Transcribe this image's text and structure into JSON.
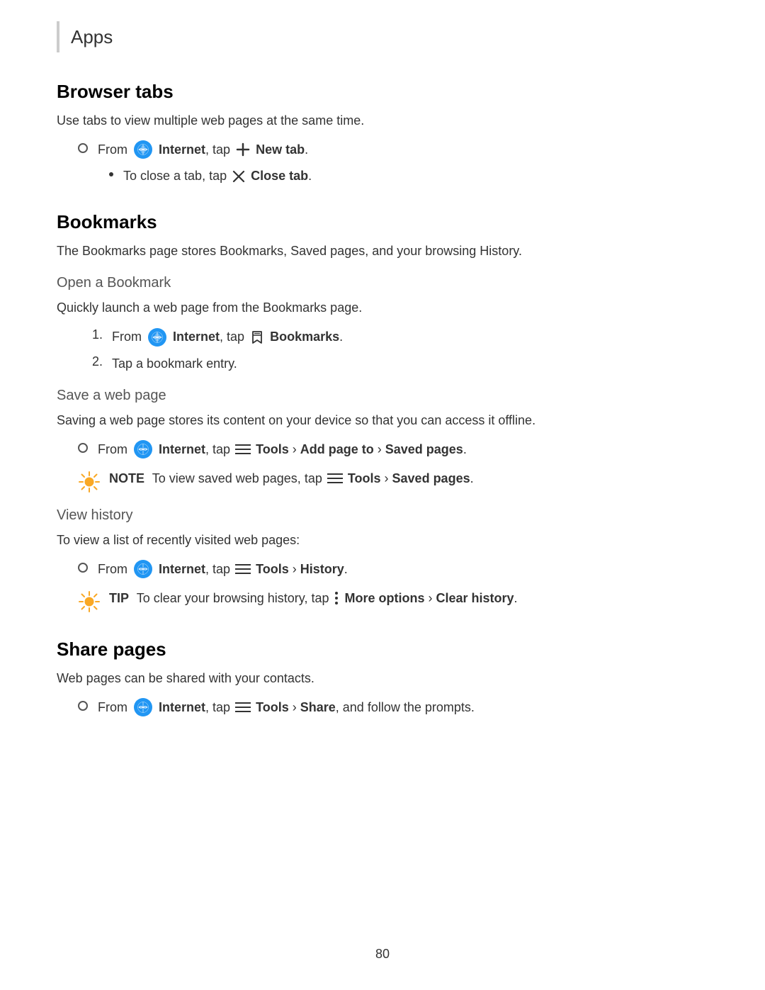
{
  "header": {
    "bar": true,
    "title": "Apps"
  },
  "sections": [
    {
      "id": "browser-tabs",
      "title": "Browser tabs",
      "type": "main",
      "body": "Use tabs to view multiple web pages at the same time.",
      "items": [
        {
          "type": "circle-bullet",
          "text_parts": [
            {
              "type": "text",
              "value": "From "
            },
            {
              "type": "internet-icon"
            },
            {
              "type": "bold",
              "value": "Internet"
            },
            {
              "type": "text",
              "value": ", tap "
            },
            {
              "type": "plus-icon"
            },
            {
              "type": "bold",
              "value": "New tab"
            },
            {
              "type": "text",
              "value": "."
            }
          ],
          "sub_items": [
            {
              "type": "dot-bullet",
              "text_parts": [
                {
                  "type": "text",
                  "value": "To close a tab, tap "
                },
                {
                  "type": "x-icon"
                },
                {
                  "type": "bold",
                  "value": "Close tab"
                },
                {
                  "type": "text",
                  "value": "."
                }
              ]
            }
          ]
        }
      ]
    },
    {
      "id": "bookmarks",
      "title": "Bookmarks",
      "type": "main",
      "body": "The Bookmarks page stores Bookmarks, Saved pages, and your browsing History.",
      "subsections": [
        {
          "id": "open-bookmark",
          "title": "Open a Bookmark",
          "body": "Quickly launch a web page from the Bookmarks page.",
          "items": [
            {
              "type": "numbered",
              "number": "1.",
              "text_parts": [
                {
                  "type": "text",
                  "value": "From "
                },
                {
                  "type": "internet-icon"
                },
                {
                  "type": "bold",
                  "value": "Internet"
                },
                {
                  "type": "text",
                  "value": ", tap "
                },
                {
                  "type": "bookmark-icon"
                },
                {
                  "type": "bold",
                  "value": "Bookmarks"
                },
                {
                  "type": "text",
                  "value": "."
                }
              ]
            },
            {
              "type": "numbered",
              "number": "2.",
              "text_parts": [
                {
                  "type": "text",
                  "value": "Tap a bookmark entry."
                }
              ]
            }
          ]
        },
        {
          "id": "save-web-page",
          "title": "Save a web page",
          "body": "Saving a web page stores its content on your device so that you can access it offline.",
          "items": [
            {
              "type": "circle-bullet",
              "text_parts": [
                {
                  "type": "text",
                  "value": "From "
                },
                {
                  "type": "internet-icon"
                },
                {
                  "type": "bold",
                  "value": "Internet"
                },
                {
                  "type": "text",
                  "value": ", tap "
                },
                {
                  "type": "menu-icon"
                },
                {
                  "type": "bold",
                  "value": "Tools"
                },
                {
                  "type": "text",
                  "value": " › "
                },
                {
                  "type": "bold",
                  "value": "Add page to"
                },
                {
                  "type": "text",
                  "value": " › "
                },
                {
                  "type": "bold",
                  "value": "Saved pages"
                },
                {
                  "type": "text",
                  "value": "."
                }
              ]
            }
          ],
          "notes": [
            {
              "type": "note",
              "label": "NOTE",
              "text_parts": [
                {
                  "type": "text",
                  "value": "To view saved web pages, tap "
                },
                {
                  "type": "menu-icon"
                },
                {
                  "type": "bold",
                  "value": "Tools"
                },
                {
                  "type": "text",
                  "value": " › "
                },
                {
                  "type": "bold",
                  "value": "Saved pages"
                },
                {
                  "type": "text",
                  "value": "."
                }
              ]
            }
          ]
        },
        {
          "id": "view-history",
          "title": "View history",
          "body": "To view a list of recently visited web pages:",
          "items": [
            {
              "type": "circle-bullet",
              "text_parts": [
                {
                  "type": "text",
                  "value": "From "
                },
                {
                  "type": "internet-icon"
                },
                {
                  "type": "bold",
                  "value": "Internet"
                },
                {
                  "type": "text",
                  "value": ", tap "
                },
                {
                  "type": "menu-icon"
                },
                {
                  "type": "bold",
                  "value": "Tools"
                },
                {
                  "type": "text",
                  "value": " › "
                },
                {
                  "type": "bold",
                  "value": "History"
                },
                {
                  "type": "text",
                  "value": "."
                }
              ]
            }
          ],
          "notes": [
            {
              "type": "tip",
              "label": "TIP",
              "text_parts": [
                {
                  "type": "text",
                  "value": "To clear your browsing history, tap "
                },
                {
                  "type": "dots-icon"
                },
                {
                  "type": "bold",
                  "value": "More options"
                },
                {
                  "type": "text",
                  "value": " › "
                },
                {
                  "type": "bold",
                  "value": "Clear history"
                },
                {
                  "type": "text",
                  "value": "."
                }
              ]
            }
          ]
        }
      ]
    },
    {
      "id": "share-pages",
      "title": "Share pages",
      "type": "main",
      "body": "Web pages can be shared with your contacts.",
      "items": [
        {
          "type": "circle-bullet",
          "text_parts": [
            {
              "type": "text",
              "value": "From "
            },
            {
              "type": "internet-icon"
            },
            {
              "type": "bold",
              "value": "Internet"
            },
            {
              "type": "text",
              "value": ", tap "
            },
            {
              "type": "menu-icon"
            },
            {
              "type": "bold",
              "value": "Tools"
            },
            {
              "type": "text",
              "value": " › "
            },
            {
              "type": "bold",
              "value": "Share"
            },
            {
              "type": "text",
              "value": ", and follow the prompts."
            }
          ]
        }
      ]
    }
  ],
  "footer": {
    "page_number": "80"
  }
}
